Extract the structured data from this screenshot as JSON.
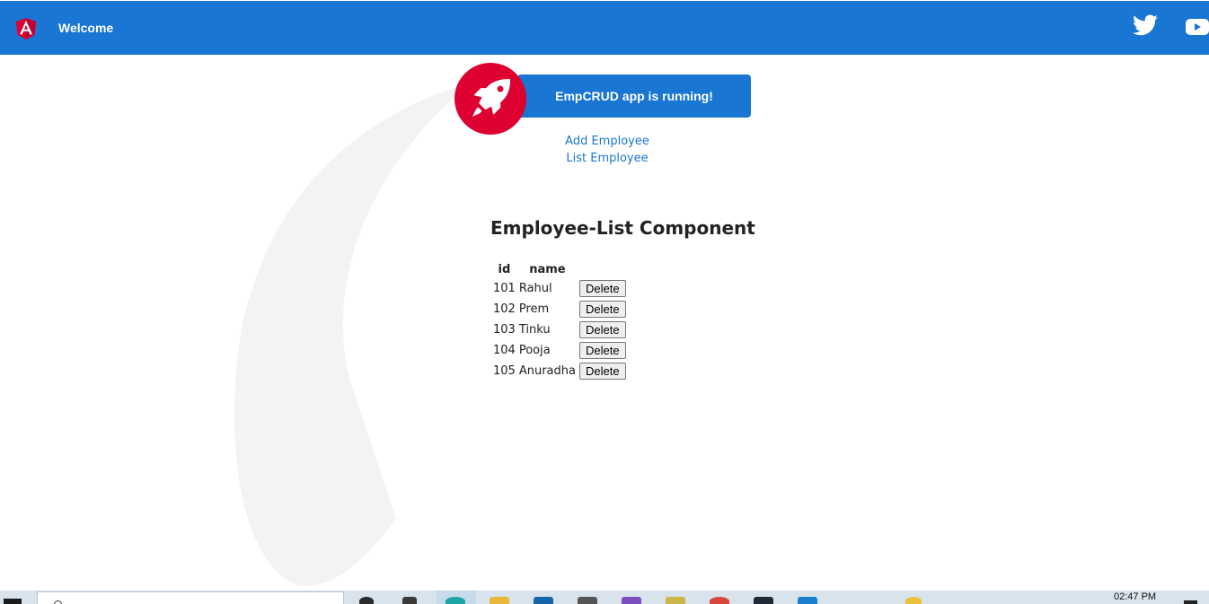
{
  "toolbar": {
    "title": "Welcome",
    "logo_icon": "angular-logo-icon",
    "social_icons": [
      "twitter-icon",
      "youtube-icon"
    ]
  },
  "card": {
    "icon": "rocket-icon",
    "text": "EmpCRUD app is running!"
  },
  "nav_links": {
    "add": "Add Employee",
    "list": "List Employee"
  },
  "component": {
    "heading": "Employee-List Component",
    "columns": {
      "id": "id",
      "name": "name"
    },
    "delete_label": "Delete",
    "rows": [
      {
        "id": "101",
        "name": "Rahul"
      },
      {
        "id": "102",
        "name": "Prem"
      },
      {
        "id": "103",
        "name": "Tinku"
      },
      {
        "id": "104",
        "name": "Pooja"
      },
      {
        "id": "105",
        "name": "Anuradha"
      }
    ]
  },
  "taskbar": {
    "clock": "02:47 PM"
  },
  "colors": {
    "primary": "#1976d2",
    "angular_red": "#dd0031",
    "swoosh": "#f3f3f3",
    "link": "#1976d2"
  }
}
